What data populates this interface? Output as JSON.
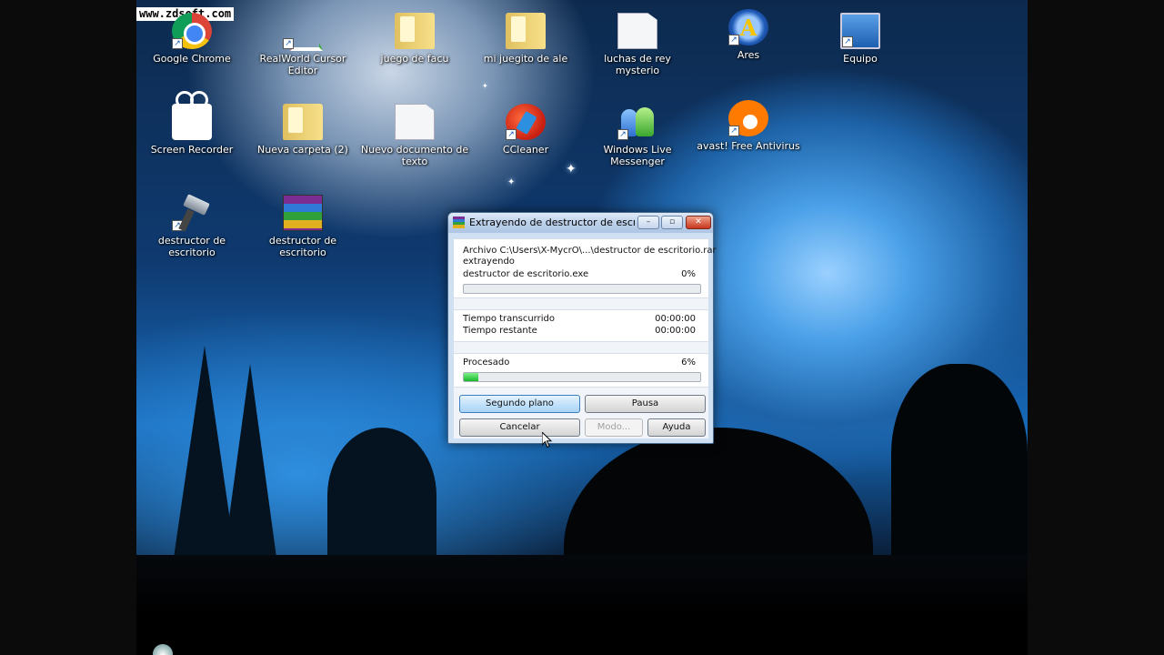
{
  "watermark": "www.zdsoft.com",
  "desktop_icons": [
    {
      "label": "Google Chrome",
      "icon": "chrome-icon"
    },
    {
      "label": "RealWorld Cursor Editor",
      "icon": "realworld-icon"
    },
    {
      "label": "juego de facu",
      "icon": "folder-icon"
    },
    {
      "label": "mi juegito de ale",
      "icon": "folder-icon"
    },
    {
      "label": "luchas de rey mysterio",
      "icon": "document-icon"
    },
    {
      "label": "Ares",
      "icon": "ares-icon"
    },
    {
      "label": "Equipo",
      "icon": "computer-icon"
    },
    {
      "label": "Screen Recorder",
      "icon": "camera-icon"
    },
    {
      "label": "Nueva carpeta (2)",
      "icon": "folder-icon"
    },
    {
      "label": "Nuevo documento de texto",
      "icon": "document-icon"
    },
    {
      "label": "CCleaner",
      "icon": "ccleaner-icon"
    },
    {
      "label": "Windows Live Messenger",
      "icon": "messenger-icon"
    },
    {
      "label": "avast! Free Antivirus",
      "icon": "avast-icon"
    },
    {
      "label": "destructor de escritorio",
      "icon": "hammer-icon"
    },
    {
      "label": "destructor de escritorio",
      "icon": "winrar-icon"
    }
  ],
  "dialog": {
    "title": "Extrayendo de destructor de escrit...",
    "archive_line": "Archivo C:\\Users\\X-MycrO\\...\\destructor de escritorio.rar",
    "status": "extrayendo",
    "current_file": "destructor de escritorio.exe",
    "file_percent": "0%",
    "file_progress": 0.0,
    "elapsed_label": "Tiempo transcurrido",
    "elapsed_value": "00:00:00",
    "remaining_label": "Tiempo restante",
    "remaining_value": "00:00:00",
    "processed_label": "Procesado",
    "processed_percent": "6%",
    "processed_progress": 0.06,
    "buttons": {
      "background": "Segundo plano",
      "pause": "Pausa",
      "cancel": "Cancelar",
      "mode": "Modo...",
      "help": "Ayuda"
    },
    "window_controls": {
      "minimize": "–",
      "maximize": "▫",
      "close": "✕"
    }
  }
}
